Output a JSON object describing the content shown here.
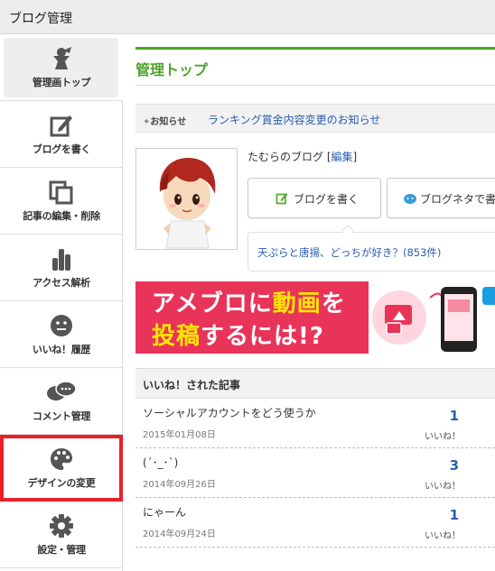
{
  "app": {
    "title": "ブログ管理"
  },
  "sidebar": {
    "items": [
      {
        "label": "管理画トップ",
        "icon": "meeple-icon"
      },
      {
        "label": "ブログを書く",
        "icon": "edit-icon"
      },
      {
        "label": "記事の編集・削除",
        "icon": "copy-icon"
      },
      {
        "label": "アクセス解析",
        "icon": "bar-chart-icon"
      },
      {
        "label": "いいね！履歴",
        "icon": "smiley-icon"
      },
      {
        "label": "コメント管理",
        "icon": "speech-bubbles-icon"
      },
      {
        "label": "デザインの変更",
        "icon": "palette-icon"
      },
      {
        "label": "設定・管理",
        "icon": "gear-icon"
      }
    ]
  },
  "main": {
    "title": "管理トップ",
    "notice": {
      "label": "お知らせ",
      "link": "ランキング賞金内容変更のお知らせ"
    },
    "blog": {
      "name": "たむらのブログ",
      "edit": "編集"
    },
    "buttons": {
      "write": "ブログを書く",
      "neta": "ブログネタで書"
    },
    "question": "天ぷらと唐揚、どっちが好き？(853件)",
    "banner": {
      "line1a": "アメブロに",
      "line1b": "動画",
      "line1c": "を",
      "line2a": "投稿",
      "line2b": "するには!?"
    },
    "liked": {
      "header": "いいね！された記事",
      "rows": [
        {
          "title": "ソーシャルアカウントをどう使うか",
          "date": "2015年01月08日",
          "count": "1",
          "unit": "いいね！"
        },
        {
          "title": "(´･_･`)",
          "date": "2014年09月26日",
          "count": "3",
          "unit": "いいね！"
        },
        {
          "title": "にゃーん",
          "date": "2014年09月24日",
          "count": "1",
          "unit": "いいね！"
        }
      ]
    }
  },
  "colors": {
    "accent_green": "#45a81e",
    "link_blue": "#2a5db0",
    "highlight_red": "#e8202a",
    "banner_pink": "#e62c55"
  }
}
